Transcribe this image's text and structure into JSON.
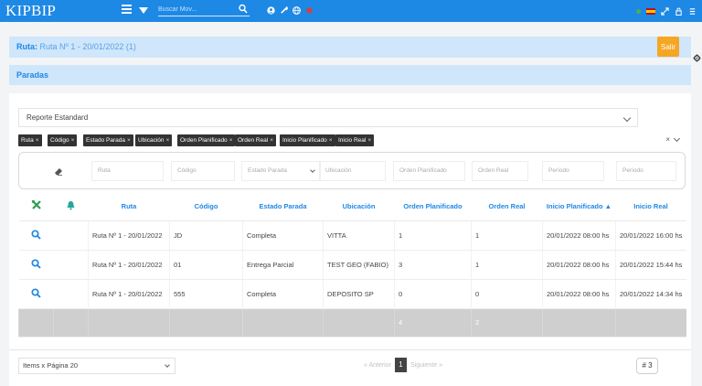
{
  "app": {
    "logo": "KIPBIP"
  },
  "topbar": {
    "search_placeholder": "Buscar Mov..."
  },
  "route": {
    "label": "Ruta:",
    "value": "Ruta Nº 1 - 20/01/2022 (1)",
    "exit_label": "Salir"
  },
  "section": {
    "title": "Paradas"
  },
  "report": {
    "selected": "Reporte Estandard"
  },
  "chips": [
    {
      "label": "Ruta"
    },
    {
      "label": "Código"
    },
    {
      "label": "Estado Parada"
    },
    {
      "label": "Ubicación"
    },
    {
      "label": "Orden Planificado"
    },
    {
      "label": "Orden Real"
    },
    {
      "label": "Inicio Planificado"
    },
    {
      "label": "Inicio Real"
    }
  ],
  "chip_remove": "×",
  "clear_all": "×",
  "filters": {
    "ruta": "Ruta",
    "codigo": "Código",
    "estado": "Estado Parada",
    "ubicacion": "Ubicación",
    "orden_plan": "Orden Planificado",
    "orden_real": "Orden Real",
    "inicio_plan": "Período",
    "inicio_real": "Período"
  },
  "columns": {
    "ruta": "Ruta",
    "codigo": "Código",
    "estado": "Estado Parada",
    "ubicacion": "Ubicación",
    "orden_plan": "Orden Planificado",
    "orden_real": "Orden Real",
    "inicio_plan": "Inicio Planificado ▲",
    "inicio_real": "Inicio Real"
  },
  "rows": [
    {
      "ruta": "Ruta Nº 1 - 20/01/2022",
      "codigo": "JD",
      "estado": "Completa",
      "ubicacion": "VITTA",
      "orden_plan": "1",
      "orden_real": "1",
      "inicio_plan": "20/01/2022 08:00 hs",
      "inicio_real": "20/01/2022 16:00 hs"
    },
    {
      "ruta": "Ruta Nº 1 - 20/01/2022",
      "codigo": "01",
      "estado": "Entrega Parcial",
      "ubicacion": "TEST GEO (FABIO)",
      "orden_plan": "3",
      "orden_real": "1",
      "inicio_plan": "20/01/2022 08:00 hs",
      "inicio_real": "20/01/2022 15:44 hs"
    },
    {
      "ruta": "Ruta Nº 1 - 20/01/2022",
      "codigo": "555",
      "estado": "Completa",
      "ubicacion": "DEPOSITO SP",
      "orden_plan": "0",
      "orden_real": "0",
      "inicio_plan": "20/01/2022 08:00 hs",
      "inicio_real": "20/01/2022 14:34 hs"
    }
  ],
  "totals": {
    "orden_plan": "4",
    "orden_real": "2"
  },
  "footer": {
    "page_size": "Items x Página 20",
    "prev": "« Anterior",
    "page": "1",
    "next": "Siguiente »",
    "count": "# 3"
  },
  "colors": {
    "primary": "#1e88e5",
    "exit": "#f5a623",
    "tool_green": "#2e9e4f",
    "tool_teal": "#26a69a"
  }
}
